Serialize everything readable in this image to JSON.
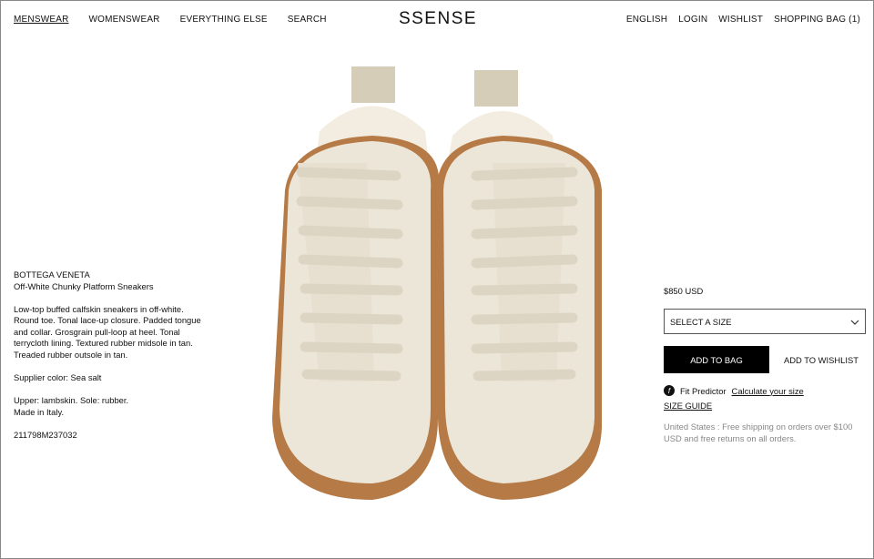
{
  "nav": {
    "left": [
      "MENSWEAR",
      "WOMENSWEAR",
      "EVERYTHING ELSE",
      "SEARCH"
    ],
    "logo": "SSENSE",
    "right": [
      "ENGLISH",
      "LOGIN",
      "WISHLIST",
      "SHOPPING BAG (1)"
    ]
  },
  "product": {
    "brand": "BOTTEGA VENETA",
    "name": "Off-White Chunky Platform Sneakers",
    "description": "Low-top buffed calfskin sneakers in off-white. Round toe. Tonal lace-up closure. Padded tongue and collar. Grosgrain pull-loop at heel. Tonal terrycloth lining. Textured rubber midsole in tan. Treaded rubber outsole in tan.",
    "supplier_color": "Supplier color: Sea salt",
    "composition_1": "Upper: lambskin. Sole: rubber.",
    "composition_2": "Made in Italy.",
    "sku": "211798M237032"
  },
  "buy": {
    "price": "$850 USD",
    "size_placeholder": "SELECT A SIZE",
    "add_to_bag": "ADD TO BAG",
    "add_to_wishlist": "ADD TO WISHLIST",
    "fit_predictor": "Fit Predictor",
    "calculate_size": "Calculate your size",
    "size_guide": "SIZE GUIDE",
    "shipping": "United States : Free shipping on orders over $100 USD and free returns on all orders."
  },
  "colors": {
    "upper": "#ece6d8",
    "sole": "#b57a45",
    "laces": "#e4ddce"
  }
}
